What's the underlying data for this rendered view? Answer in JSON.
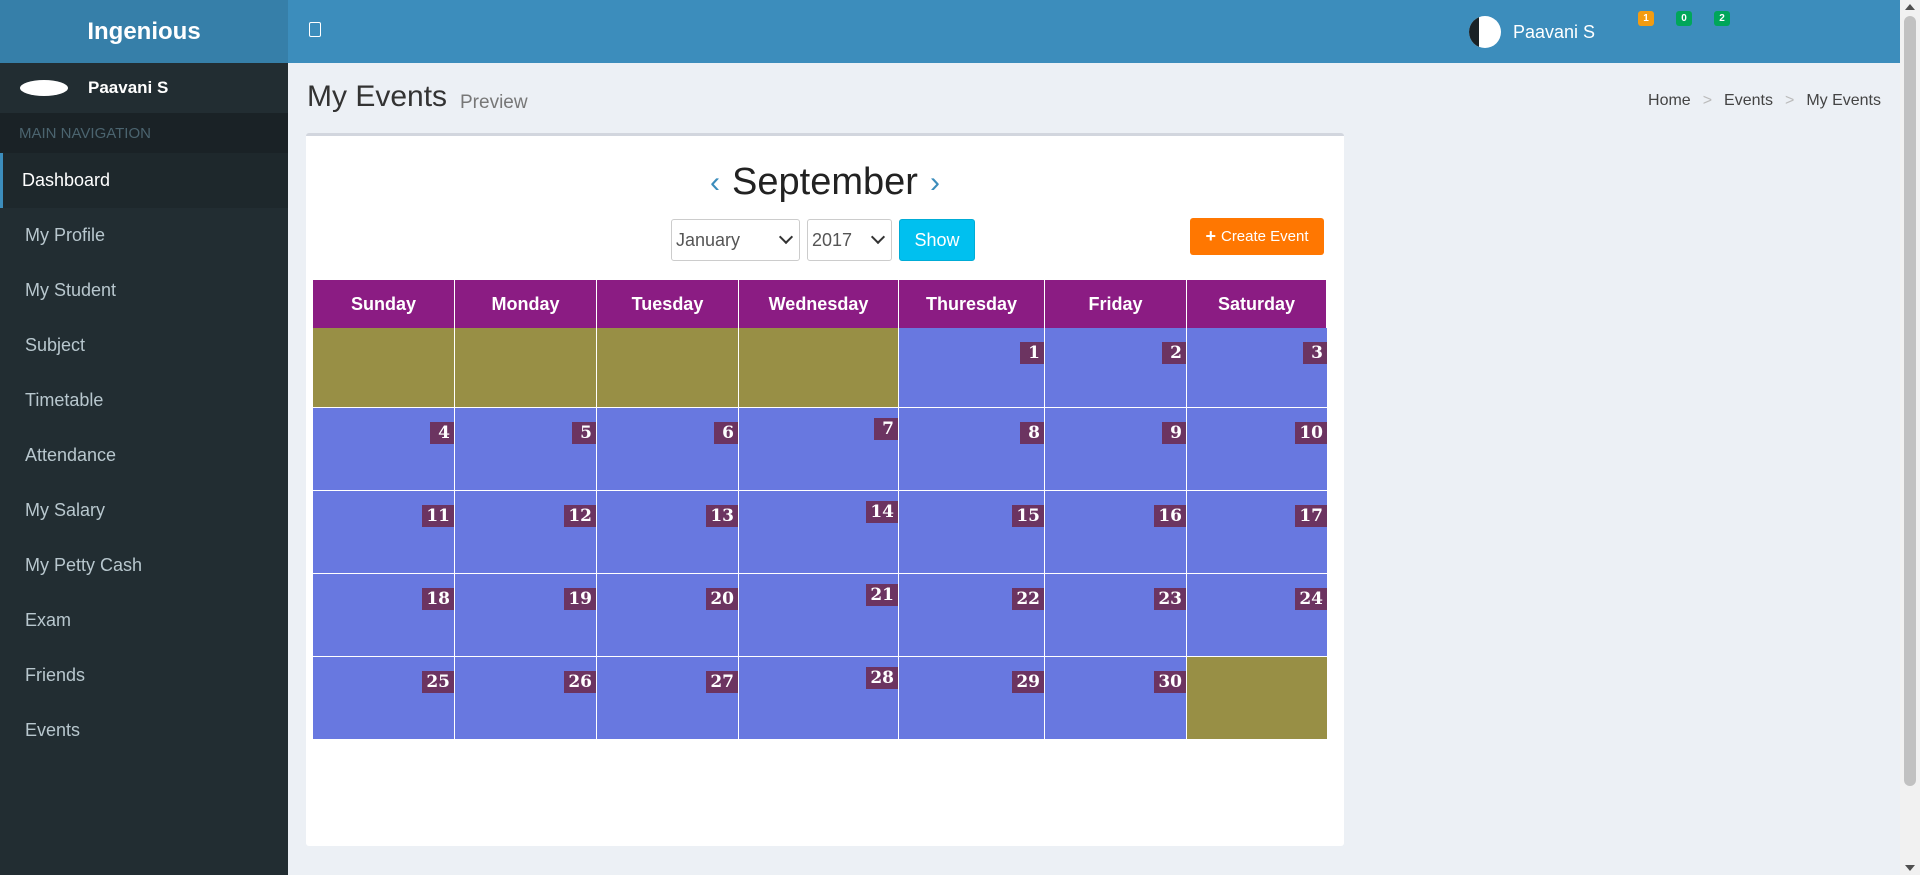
{
  "app": {
    "title": "Ingenious"
  },
  "header": {
    "notifications": [
      "1",
      "0",
      "2"
    ],
    "user_name": "Paavani S"
  },
  "sidebar": {
    "user_name": "Paavani S",
    "nav_header": "MAIN NAVIGATION",
    "items": [
      {
        "label": "Dashboard",
        "active": true
      },
      {
        "label": "My Profile"
      },
      {
        "label": "My Student"
      },
      {
        "label": "Subject"
      },
      {
        "label": "Timetable"
      },
      {
        "label": "Attendance"
      },
      {
        "label": "My Salary"
      },
      {
        "label": "My Petty Cash"
      },
      {
        "label": "Exam"
      },
      {
        "label": "Friends"
      },
      {
        "label": "Events"
      }
    ]
  },
  "page": {
    "title": "My Events",
    "subtitle": "Preview",
    "breadcrumb": [
      "Home",
      "Events",
      "My Events"
    ]
  },
  "calendar": {
    "month": "September",
    "prev_icon": "‹",
    "next_icon": "›",
    "month_select": "January",
    "year_select": "2017",
    "show_label": "Show",
    "create_label": "Create Event",
    "weekdays": [
      "Sunday",
      "Monday",
      "Tuesday",
      "Wednesday",
      "Thuresday",
      "Friday",
      "Saturday"
    ],
    "weeks": [
      [
        "",
        "",
        "",
        "",
        "1",
        "2",
        "3"
      ],
      [
        "4",
        "5",
        "6",
        "7",
        "8",
        "9",
        "10"
      ],
      [
        "11",
        "12",
        "13",
        "14",
        "15",
        "16",
        "17"
      ],
      [
        "18",
        "19",
        "20",
        "21",
        "22",
        "23",
        "24"
      ],
      [
        "25",
        "26",
        "27",
        "28",
        "29",
        "30",
        ""
      ]
    ],
    "colors": {
      "header": "#8b1c83",
      "day": "#6878e0",
      "empty": "#988f45",
      "daynum": "#6c3461"
    }
  }
}
